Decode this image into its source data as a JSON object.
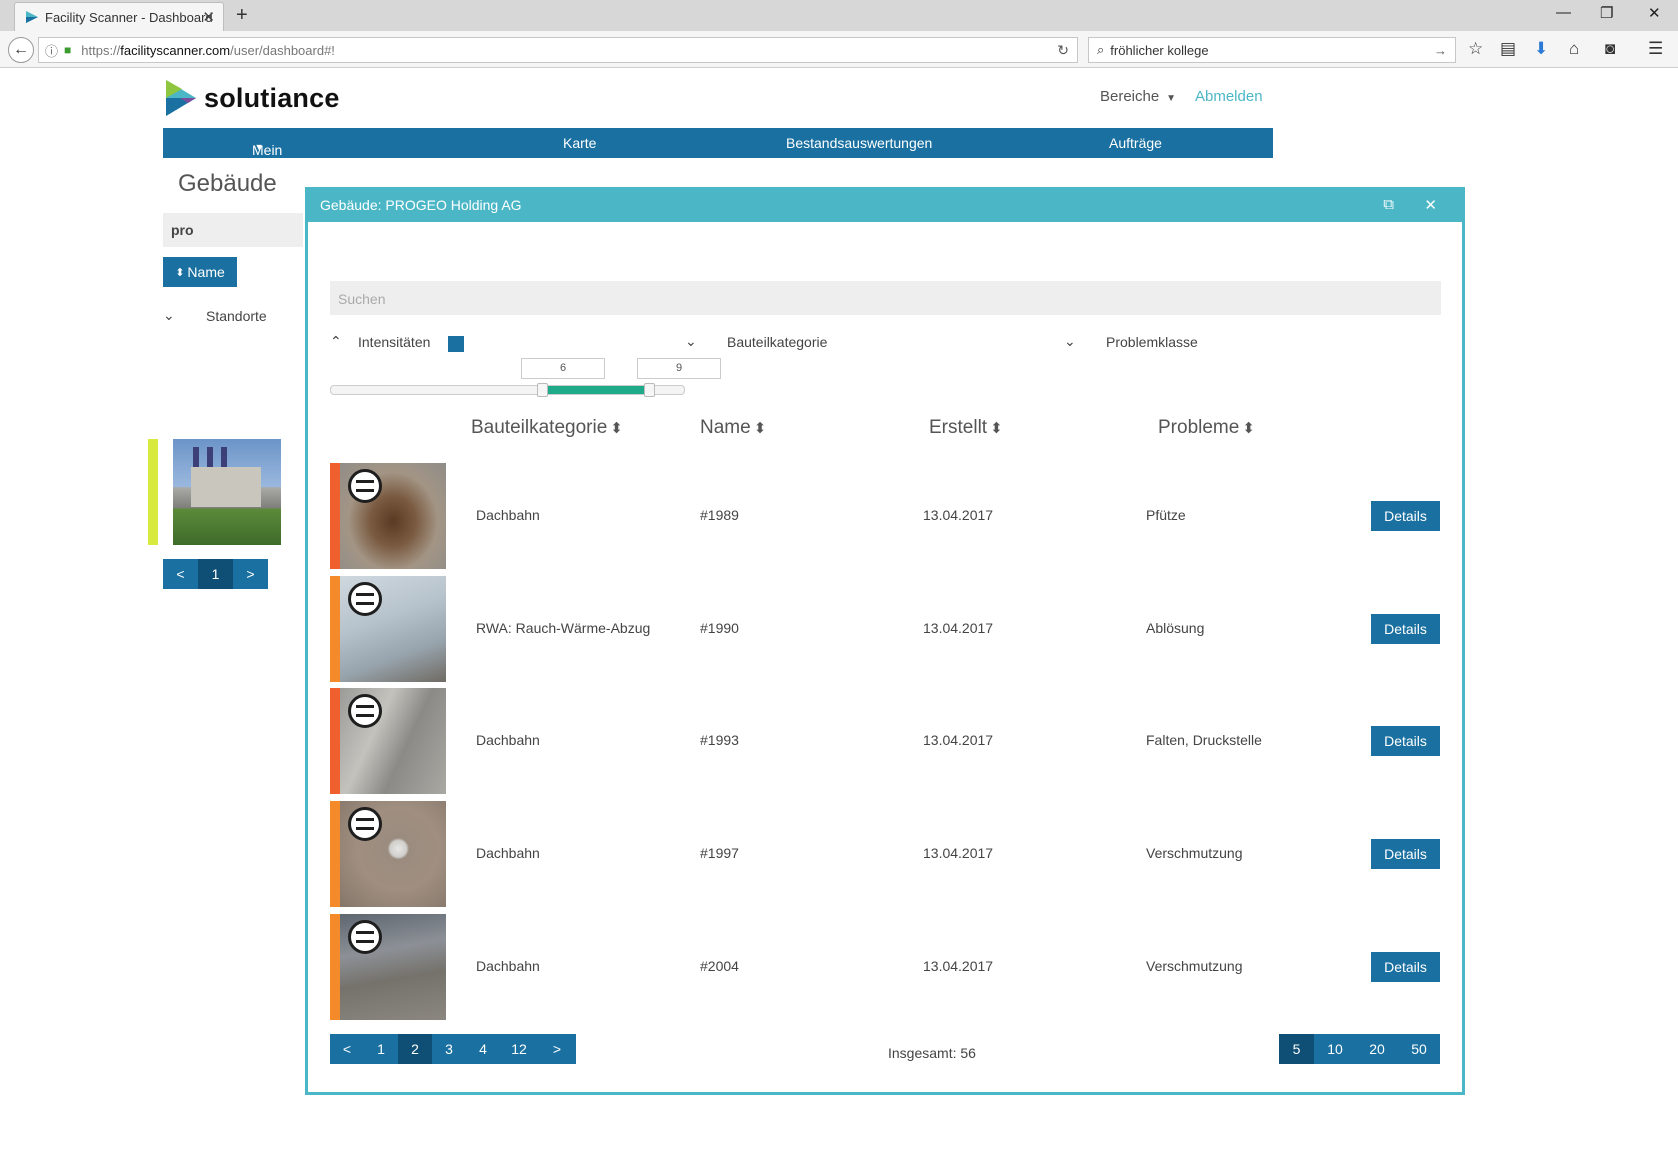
{
  "browser": {
    "tab_title": "Facility Scanner - Dashboard",
    "url_proto": "https://",
    "url_host": "facilityscanner.com",
    "url_path": "/user/dashboard#!",
    "search_value": "fröhlicher kollege"
  },
  "header": {
    "logo_text": "solutiance",
    "bereiche": "Bereiche",
    "abmelden": "Abmelden"
  },
  "mainnav": {
    "items": [
      "Mein Bestand",
      "Karte",
      "Bestandsauswertungen",
      "Aufträge"
    ]
  },
  "sidebar": {
    "title": "Gebäude",
    "filter_value": "pro",
    "sort_label": "Name",
    "standorte": "Standorte",
    "pager": [
      "<",
      "1",
      ">"
    ]
  },
  "modal": {
    "title": "Gebäude: PROGEO Holding AG",
    "search_placeholder": "Suchen",
    "filters": {
      "intensitaeten": "Intensitäten",
      "bauteilkategorie": "Bauteilkategorie",
      "problemklasse": "Problemklasse"
    },
    "range": {
      "min_value": "6",
      "max_value": "9",
      "low": 6,
      "high": 9,
      "scale_max": 10
    },
    "columns": [
      "Bauteilkategorie",
      "Name",
      "Erstellt",
      "Probleme"
    ],
    "rows": [
      {
        "category": "Dachbahn",
        "name": "#1989",
        "created": "13.04.2017",
        "problems": "Pfütze",
        "severity_color": "#f0602f",
        "details": "Details"
      },
      {
        "category": "RWA: Rauch-Wärme-Abzug",
        "name": "#1990",
        "created": "13.04.2017",
        "problems": "Ablösung",
        "severity_color": "#f58a2a",
        "details": "Details"
      },
      {
        "category": "Dachbahn",
        "name": "#1993",
        "created": "13.04.2017",
        "problems": "Falten, Druckstelle",
        "severity_color": "#f0602f",
        "details": "Details"
      },
      {
        "category": "Dachbahn",
        "name": "#1997",
        "created": "13.04.2017",
        "problems": "Verschmutzung",
        "severity_color": "#f58a2a",
        "details": "Details"
      },
      {
        "category": "Dachbahn",
        "name": "#2004",
        "created": "13.04.2017",
        "problems": "Verschmutzung",
        "severity_color": "#f58a2a",
        "details": "Details"
      }
    ],
    "pager": [
      "<",
      "1",
      "2",
      "3",
      "4",
      "12",
      ">"
    ],
    "active_page": "2",
    "total": "Insgesamt: 56",
    "page_sizes": [
      "5",
      "10",
      "20",
      "50"
    ],
    "active_size": "5"
  },
  "colors": {
    "primary": "#1a70a0",
    "accent": "#4bb7c6",
    "slider_fill": "#1faa8a",
    "location_marker": "#d9ea3e"
  }
}
